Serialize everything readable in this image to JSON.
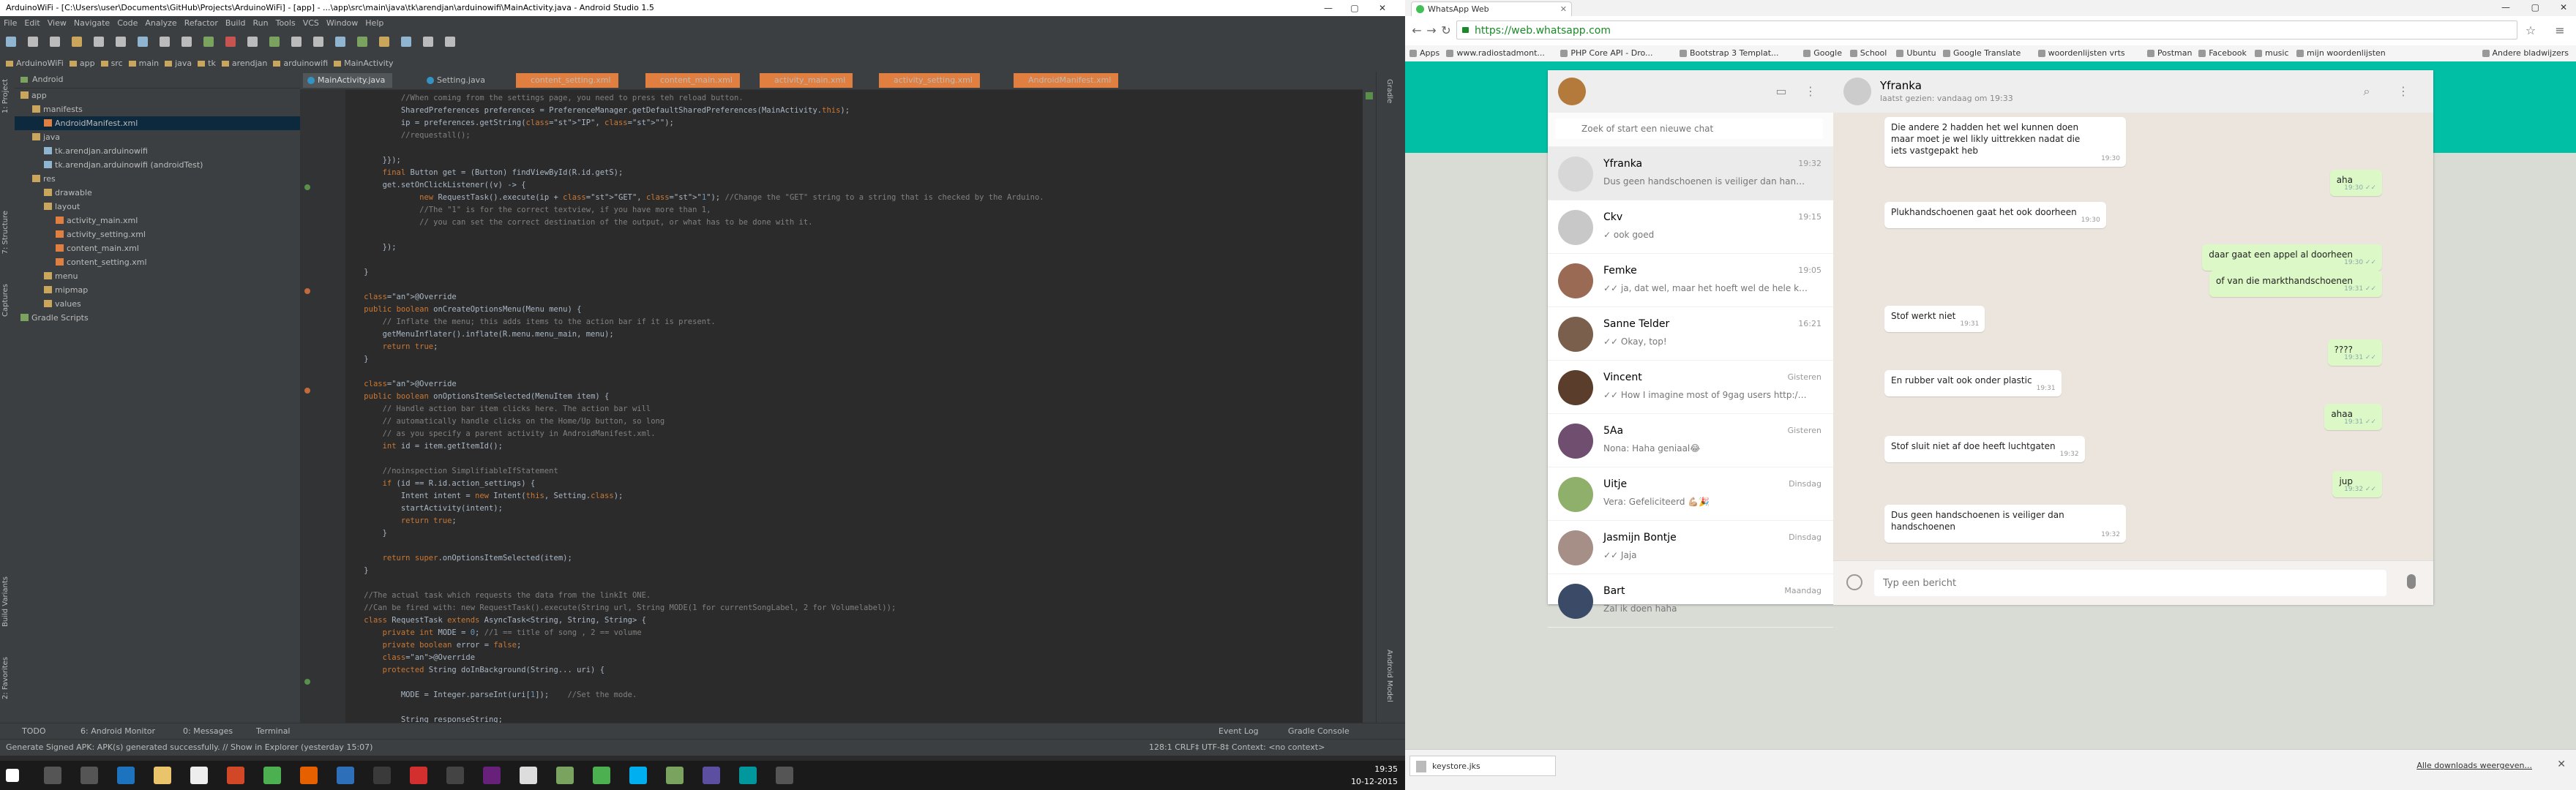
{
  "android_studio": {
    "title": "ArduinoWiFi - [C:\\Users\\user\\Documents\\GitHub\\Projects\\ArduinoWiFi] - [app] - ...\\app\\src\\main\\java\\tk\\arendjan\\arduinowifi\\MainActivity.java - Android Studio 1.5",
    "menu": [
      "File",
      "Edit",
      "View",
      "Navigate",
      "Code",
      "Analyze",
      "Refactor",
      "Build",
      "Run",
      "Tools",
      "VCS",
      "Window",
      "Help"
    ],
    "breadcrumbs": [
      "ArduinoWiFi",
      "app",
      "src",
      "main",
      "java",
      "tk",
      "arendjan",
      "arduinowifi",
      "MainActivity"
    ],
    "project_view": "Android",
    "tree": [
      {
        "label": "app",
        "depth": 0,
        "icon": "folder"
      },
      {
        "label": "manifests",
        "depth": 1,
        "icon": "folder"
      },
      {
        "label": "AndroidManifest.xml",
        "depth": 2,
        "icon": "xml",
        "selected": true
      },
      {
        "label": "java",
        "depth": 1,
        "icon": "folder"
      },
      {
        "label": "tk.arendjan.arduinowifi",
        "depth": 2,
        "icon": "package"
      },
      {
        "label": "tk.arendjan.arduinowifi (androidTest)",
        "depth": 2,
        "icon": "package"
      },
      {
        "label": "res",
        "depth": 1,
        "icon": "folder"
      },
      {
        "label": "drawable",
        "depth": 2,
        "icon": "folder"
      },
      {
        "label": "layout",
        "depth": 2,
        "icon": "folder"
      },
      {
        "label": "activity_main.xml",
        "depth": 3,
        "icon": "xml"
      },
      {
        "label": "activity_setting.xml",
        "depth": 3,
        "icon": "xml"
      },
      {
        "label": "content_main.xml",
        "depth": 3,
        "icon": "xml"
      },
      {
        "label": "content_setting.xml",
        "depth": 3,
        "icon": "xml"
      },
      {
        "label": "menu",
        "depth": 2,
        "icon": "folder"
      },
      {
        "label": "mipmap",
        "depth": 2,
        "icon": "folder"
      },
      {
        "label": "values",
        "depth": 2,
        "icon": "folder"
      },
      {
        "label": "Gradle Scripts",
        "depth": 0,
        "icon": "gradle"
      }
    ],
    "tabs": [
      {
        "label": "MainActivity.java",
        "type": "java",
        "active": true
      },
      {
        "label": "Setting.java",
        "type": "java"
      },
      {
        "label": "content_setting.xml",
        "type": "xml"
      },
      {
        "label": "content_main.xml",
        "type": "xml"
      },
      {
        "label": "activity_main.xml",
        "type": "xml"
      },
      {
        "label": "activity_setting.xml",
        "type": "xml"
      },
      {
        "label": "AndroidManifest.xml",
        "type": "xml"
      }
    ],
    "left_strip": [
      "1: Project",
      "7: Structure",
      "Captures",
      "Build Variants",
      "2: Favorites"
    ],
    "right_strip": [
      "Gradle",
      "Android Model"
    ],
    "bottom_tools": [
      "TODO",
      "6: Android Monitor",
      "0: Messages",
      "Terminal"
    ],
    "bottom_right": [
      "Event Log",
      "Gradle Console"
    ],
    "status_text": "Generate Signed APK: APK(s) generated successfully. // Show in Explorer (yesterday 15:07)",
    "status_right": "128:1   CRLF‡   UTF-8‡   Context: <no context>"
  },
  "taskbar": {
    "time": "19:35",
    "date": "10-12-2015"
  },
  "chrome": {
    "tab_title": "WhatsApp Web",
    "url": "https://web.whatsapp.com",
    "bookmarks": [
      "Apps",
      "www.radiostadmont...",
      "PHP Core API - Dro...",
      "Bootstrap 3 Templat...",
      "Google",
      "School",
      "Ubuntu",
      "Google Translate",
      "woordenlijsten vrts",
      "Postman",
      "Facebook",
      "music",
      "mijn woordenlijsten",
      "Andere bladwijzers"
    ],
    "download_file": "keystore.jks",
    "all_downloads": "Alle downloads weergeven..."
  },
  "whatsapp": {
    "search_placeholder": "Zoek of start een nieuwe chat",
    "compose_placeholder": "Typ een bericht",
    "active_contact": "Yfranka",
    "last_seen": "laatst gezien: vandaag om 19:33",
    "chats": [
      {
        "name": "Yfranka",
        "time": "19:32",
        "preview": "Dus geen handschoenen is veiliger dan hand...",
        "avatar_color": "#d7d7d7"
      },
      {
        "name": "Ckv",
        "time": "19:15",
        "preview": "✓ ook goed",
        "avatar_color": "#c8c8c8"
      },
      {
        "name": "Femke",
        "time": "19:05",
        "preview": "✓✓ ja, dat wel, maar het hoeft wel de hele kla...",
        "avatar_color": "#9b6a54"
      },
      {
        "name": "Sanne Telder",
        "time": "16:21",
        "preview": "✓✓ Okay, top!",
        "avatar_color": "#7a5f4c"
      },
      {
        "name": "Vincent",
        "time": "Gisteren",
        "preview": "✓✓ How I imagine most of 9gag users http://...",
        "avatar_color": "#5a3d2b"
      },
      {
        "name": "5Aa",
        "time": "Gisteren",
        "preview": "Nona: Haha geniaal😂",
        "avatar_color": "#6f4e6f"
      },
      {
        "name": "Uitje",
        "time": "Dinsdag",
        "preview": "Vera: Gefeliciteerd 💪🏼🎉",
        "avatar_color": "#8fb06a"
      },
      {
        "name": "Jasmijn Bontje",
        "time": "Dinsdag",
        "preview": "✓✓ Jaja",
        "avatar_color": "#a58f86"
      },
      {
        "name": "Bart",
        "time": "Maandag",
        "preview": "Zal ik doen haha",
        "avatar_color": "#3b4a66"
      }
    ],
    "messages": [
      {
        "dir": "in",
        "text": "Die andere 2 hadden het wel kunnen doen maar moet je wel likly uittrekken nadat die iets vastgepakt heb",
        "time": "19:30"
      },
      {
        "dir": "out",
        "text": "aha",
        "time": "19:30 ✓✓"
      },
      {
        "dir": "in",
        "text": "Plukhandschoenen gaat het ook doorheen",
        "time": "19:30"
      },
      {
        "dir": "out",
        "text": "daar gaat een appel al doorheen",
        "time": "19:30 ✓✓"
      },
      {
        "dir": "out",
        "text": "of van die markthandschoenen",
        "time": "19:31 ✓✓"
      },
      {
        "dir": "in",
        "text": "Stof werkt niet",
        "time": "19:31"
      },
      {
        "dir": "out",
        "text": "????",
        "time": "19:31 ✓✓"
      },
      {
        "dir": "in",
        "text": "En rubber valt ook onder plastic",
        "time": "19:31"
      },
      {
        "dir": "out",
        "text": "ahaa",
        "time": "19:31 ✓✓"
      },
      {
        "dir": "in",
        "text": "Stof sluit niet af doe heeft luchtgaten",
        "time": "19:32"
      },
      {
        "dir": "out",
        "text": "jup",
        "time": "19:32 ✓✓"
      },
      {
        "dir": "in",
        "text": "Dus geen handschoenen is veiliger dan handschoenen",
        "time": "19:32"
      }
    ]
  },
  "code_lines": [
    "            //When coming from the settings page, you need to press teh reload button.",
    "            SharedPreferences preferences = PreferenceManager.getDefaultSharedPreferences(MainActivity.this);",
    "            ip = preferences.getString(\"IP\", \"\");",
    "            //requestall();",
    "",
    "        }});",
    "        final Button get = (Button) findViewById(R.id.getS);",
    "        get.setOnClickListener((v) -> {",
    "                new RequestTask().execute(ip + \"GET\", \"1\"); //Change the \"GET\" string to a string that is checked by the Arduino.",
    "                //The \"1\" is for the correct textview, if you have more than 1,",
    "                // you can set the correct destination of the output, or what has to be done with it.",
    "",
    "        });",
    "",
    "    }",
    "",
    "    @Override",
    "    public boolean onCreateOptionsMenu(Menu menu) {",
    "        // Inflate the menu; this adds items to the action bar if it is present.",
    "        getMenuInflater().inflate(R.menu.menu_main, menu);",
    "        return true;",
    "    }",
    "",
    "    @Override",
    "    public boolean onOptionsItemSelected(MenuItem item) {",
    "        // Handle action bar item clicks here. The action bar will",
    "        // automatically handle clicks on the Home/Up button, so long",
    "        // as you specify a parent activity in AndroidManifest.xml.",
    "        int id = item.getItemId();",
    "",
    "        //noinspection SimplifiableIfStatement",
    "        if (id == R.id.action_settings) {",
    "            Intent intent = new Intent(this, Setting.class);",
    "            startActivity(intent);",
    "            return true;",
    "        }",
    "",
    "        return super.onOptionsItemSelected(item);",
    "    }",
    "",
    "    //The actual task which requests the data from the linkIt ONE.",
    "    //Can be fired with: new RequestTask().execute(String url, String MODE(1 for currentSongLabel, 2 for Volumelabel));",
    "    class RequestTask extends AsyncTask<String, String, String> {",
    "        private int MODE = 0; //1 == title of song , 2 == volume",
    "        private boolean error = false;",
    "        @Override",
    "        protected String doInBackground(String... uri) {",
    "",
    "            MODE = Integer.parseInt(uri[1]);    //Set the mode.",
    "",
    "            String responseString;"
  ]
}
